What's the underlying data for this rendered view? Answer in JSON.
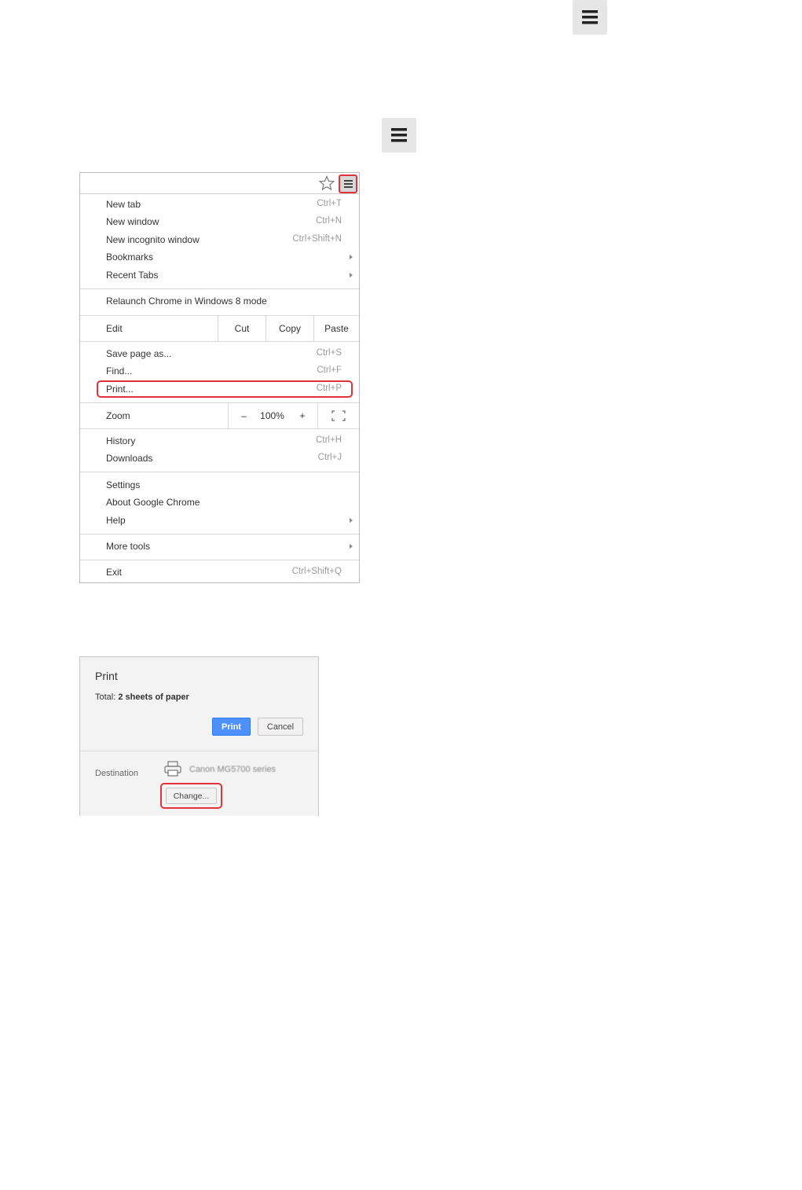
{
  "icons": {
    "top_menu": "hamburger-menu-icon",
    "mid_menu": "hamburger-menu-icon"
  },
  "colors": {
    "highlight": "#e0333a",
    "print_button": "#4d90fe"
  },
  "chrome_menu": {
    "items_group1": [
      {
        "label": "New tab",
        "shortcut": "Ctrl+T"
      },
      {
        "label": "New window",
        "shortcut": "Ctrl+N"
      },
      {
        "label": "New incognito window",
        "shortcut": "Ctrl+Shift+N"
      },
      {
        "label": "Bookmarks",
        "shortcut": ""
      },
      {
        "label": "Recent Tabs",
        "shortcut": ""
      }
    ],
    "relaunch": "Relaunch Chrome in Windows 8 mode",
    "edit": {
      "label": "Edit",
      "cut": "Cut",
      "copy": "Copy",
      "paste": "Paste"
    },
    "items_group2": [
      {
        "label": "Save page as...",
        "shortcut": "Ctrl+S"
      },
      {
        "label": "Find...",
        "shortcut": "Ctrl+F"
      },
      {
        "label": "Print...",
        "shortcut": "Ctrl+P"
      }
    ],
    "zoom": {
      "label": "Zoom",
      "minus": "–",
      "value": "100%",
      "plus": "+"
    },
    "items_group3": [
      {
        "label": "History",
        "shortcut": "Ctrl+H"
      },
      {
        "label": "Downloads",
        "shortcut": "Ctrl+J"
      }
    ],
    "items_group4": [
      {
        "label": "Settings"
      },
      {
        "label": "About Google Chrome"
      },
      {
        "label": "Help"
      }
    ],
    "more_tools": "More tools",
    "exit": {
      "label": "Exit",
      "shortcut": "Ctrl+Shift+Q"
    }
  },
  "print_dialog": {
    "title": "Print",
    "total_prefix": "Total:",
    "total_value": "2 sheets of paper",
    "print_button": "Print",
    "cancel_button": "Cancel",
    "destination_label": "Destination",
    "printer_name": "Canon MG5700 series",
    "change_button": "Change..."
  }
}
